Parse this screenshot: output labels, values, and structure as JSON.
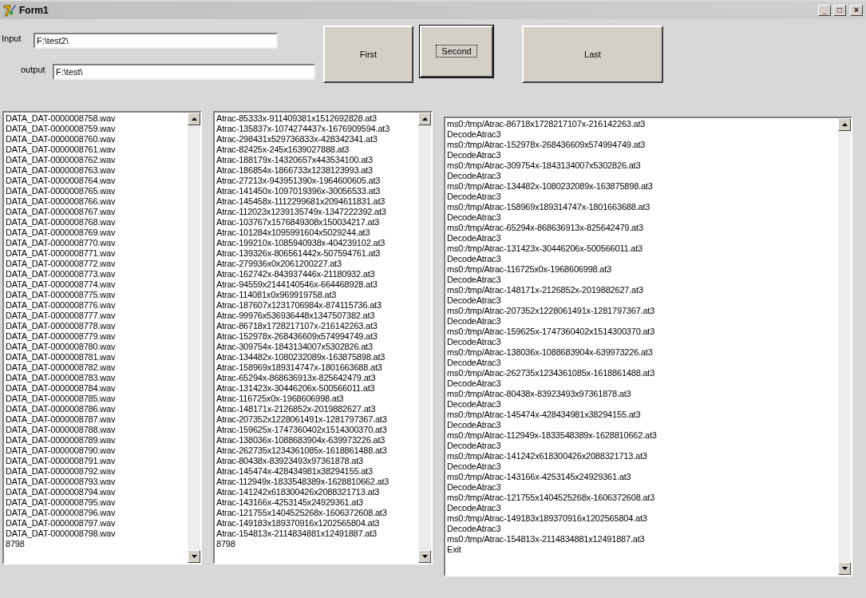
{
  "window": {
    "title": "Form1",
    "controls": [
      "_",
      "□",
      "×"
    ]
  },
  "fields": [
    {
      "label": "Input",
      "value": "F:\\test2\\"
    },
    {
      "label": "output",
      "value": "F:\\test\\"
    }
  ],
  "buttons": [
    {
      "label": "First",
      "focused": false
    },
    {
      "label": "Second",
      "focused": true
    },
    {
      "label": "Last",
      "focused": false
    }
  ],
  "lists": [
    {
      "items": [
        "DATA_DAT-0000008758.wav",
        "DATA_DAT-0000008759.wav",
        "DATA_DAT-0000008760.wav",
        "DATA_DAT-0000008761.wav",
        "DATA_DAT-0000008762.wav",
        "DATA_DAT-0000008763.wav",
        "DATA_DAT-0000008764.wav",
        "DATA_DAT-0000008765.wav",
        "DATA_DAT-0000008766.wav",
        "DATA_DAT-0000008767.wav",
        "DATA_DAT-0000008768.wav",
        "DATA_DAT-0000008769.wav",
        "DATA_DAT-0000008770.wav",
        "DATA_DAT-0000008771.wav",
        "DATA_DAT-0000008772.wav",
        "DATA_DAT-0000008773.wav",
        "DATA_DAT-0000008774.wav",
        "DATA_DAT-0000008775.wav",
        "DATA_DAT-0000008776.wav",
        "DATA_DAT-0000008777.wav",
        "DATA_DAT-0000008778.wav",
        "DATA_DAT-0000008779.wav",
        "DATA_DAT-0000008780.wav",
        "DATA_DAT-0000008781.wav",
        "DATA_DAT-0000008782.wav",
        "DATA_DAT-0000008783.wav",
        "DATA_DAT-0000008784.wav",
        "DATA_DAT-0000008785.wav",
        "DATA_DAT-0000008786.wav",
        "DATA_DAT-0000008787.wav",
        "DATA_DAT-0000008788.wav",
        "DATA_DAT-0000008789.wav",
        "DATA_DAT-0000008790.wav",
        "DATA_DAT-0000008791.wav",
        "DATA_DAT-0000008792.wav",
        "DATA_DAT-0000008793.wav",
        "DATA_DAT-0000008794.wav",
        "DATA_DAT-0000008795.wav",
        "DATA_DAT-0000008796.wav",
        "DATA_DAT-0000008797.wav",
        "DATA_DAT-0000008798.wav",
        "8798"
      ]
    },
    {
      "items": [
        "Atrac-85333x-911409381x1512692828.at3",
        "Atrac-135837x-1074274437x-1676909594.at3",
        "Atrac-298431x529736833x-428342341.at3",
        "Atrac-82425x-245x1639027888.at3",
        "Atrac-188179x-14320657x443534100.at3",
        "Atrac-186854x-1866733x1238123993.at3",
        "Atrac-27213x-943951390x-1964600605.at3",
        "Atrac-141450x-1097019396x-30056533.at3",
        "Atrac-145458x-1112299681x2094611831.at3",
        "Atrac-112023x1239135749x-1347222392.at3",
        "Atrac-103767x1576849308x150034217.at3",
        "Atrac-101284x1095991604x5029244.at3",
        "Atrac-199210x-1085940938x-404239102.at3",
        "Atrac-139326x-806561442x-507594761.at3",
        "Atrac-279936x0x2061200227.at3",
        "Atrac-162742x-843937446x-21180932.at3",
        "Atrac-94559x2144140546x-664468928.at3",
        "Atrac-114081x0x969919758.at3",
        "Atrac-187607x1231706984x-874115736.at3",
        "Atrac-99976x536936448x1347507382.at3",
        "Atrac-86718x1728217107x-216142263.at3",
        "Atrac-152978x-268436609x574994749.at3",
        "Atrac-309754x-1843134007x5302826.at3",
        "Atrac-134482x-1080232089x-163875898.at3",
        "Atrac-158969x189314747x-1801663688.at3",
        "Atrac-65294x-868636913x-825642479.at3",
        "Atrac-131423x-30446206x-500566011.at3",
        "Atrac-116725x0x-1968606998.at3",
        "Atrac-148171x-2126852x-2019882627.at3",
        "Atrac-207352x1228061491x-1281797367.at3",
        "Atrac-159625x-1747360402x1514300370.at3",
        "Atrac-138036x-1088683904x-639973226.at3",
        "Atrac-262735x1234361085x-1618861488.at3",
        "Atrac-80438x-83923493x97361878.at3",
        "Atrac-145474x-428434981x38294155.at3",
        "Atrac-112949x-1833548389x-1628810662.at3",
        "Atrac-141242x618300426x2088321713.at3",
        "Atrac-143166x-4253145x24929361.at3",
        "Atrac-121755x1404525268x-1606372608.at3",
        "Atrac-149183x189370916x1202565804.at3",
        "Atrac-154813x-2114834881x12491887.at3",
        "8798"
      ]
    },
    {
      "items": [
        "ms0:/tmp/Atrac-86718x1728217107x-216142263.at3",
        "DecodeAtrac3",
        "ms0:/tmp/Atrac-152978x-268436609x574994749.at3",
        "DecodeAtrac3",
        "ms0:/tmp/Atrac-309754x-1843134007x5302826.at3",
        "DecodeAtrac3",
        "ms0:/tmp/Atrac-134482x-1080232089x-163875898.at3",
        "DecodeAtrac3",
        "ms0:/tmp/Atrac-158969x189314747x-1801663688.at3",
        "DecodeAtrac3",
        "ms0:/tmp/Atrac-65294x-868636913x-825642479.at3",
        "DecodeAtrac3",
        "ms0:/tmp/Atrac-131423x-30446206x-500566011.at3",
        "DecodeAtrac3",
        "ms0:/tmp/Atrac-116725x0x-1968606998.at3",
        "DecodeAtrac3",
        "ms0:/tmp/Atrac-148171x-2126852x-2019882627.at3",
        "DecodeAtrac3",
        "ms0:/tmp/Atrac-207352x1228061491x-1281797367.at3",
        "DecodeAtrac3",
        "ms0:/tmp/Atrac-159625x-1747360402x1514300370.at3",
        "DecodeAtrac3",
        "ms0:/tmp/Atrac-138036x-1088683904x-639973226.at3",
        "DecodeAtrac3",
        "ms0:/tmp/Atrac-262735x1234361085x-1618861488.at3",
        "DecodeAtrac3",
        "ms0:/tmp/Atrac-80438x-83923493x97361878.at3",
        "DecodeAtrac3",
        "ms0:/tmp/Atrac-145474x-428434981x38294155.at3",
        "DecodeAtrac3",
        "ms0:/tmp/Atrac-112949x-1833548389x-1628810662.at3",
        "DecodeAtrac3",
        "ms0:/tmp/Atrac-141242x618300426x2088321713.at3",
        "DecodeAtrac3",
        "ms0:/tmp/Atrac-143166x-4253145x24929361.at3",
        "DecodeAtrac3",
        "ms0:/tmp/Atrac-121755x1404525268x-1606372608.at3",
        "DecodeAtrac3",
        "ms0:/tmp/Atrac-149183x189370916x1202565804.at3",
        "DecodeAtrac3",
        "ms0:/tmp/Atrac-154813x-2114834881x12491887.at3",
        "Exit"
      ]
    }
  ]
}
